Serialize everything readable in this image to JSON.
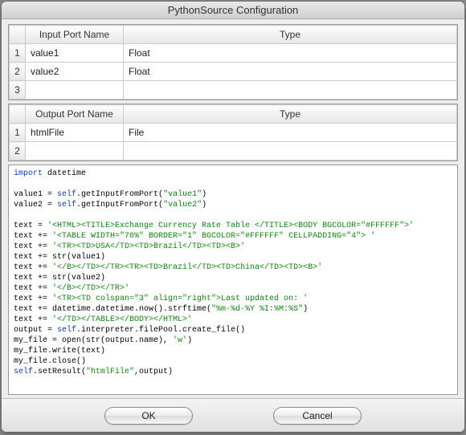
{
  "window": {
    "title": "PythonSource Configuration"
  },
  "inputTable": {
    "headers": {
      "name": "Input Port Name",
      "type": "Type"
    },
    "rows": [
      {
        "num": "1",
        "name": "value1",
        "type": "Float"
      },
      {
        "num": "2",
        "name": "value2",
        "type": "Float"
      },
      {
        "num": "3",
        "name": "",
        "type": ""
      }
    ]
  },
  "outputTable": {
    "headers": {
      "name": "Output Port Name",
      "type": "Type"
    },
    "rows": [
      {
        "num": "1",
        "name": "htmlFile",
        "type": "File"
      },
      {
        "num": "2",
        "name": "",
        "type": ""
      }
    ]
  },
  "code": {
    "l1a": "import",
    "l1b": " datetime",
    "l2a": "value1 = ",
    "l2b": "self",
    "l2c": ".getInputFromPort(",
    "l2d": "\"value1\"",
    "l2e": ")",
    "l3a": "value2 = ",
    "l3b": "self",
    "l3c": ".getInputFromPort(",
    "l3d": "\"value2\"",
    "l3e": ")",
    "l4a": "text = ",
    "l4b": "'<HTML><TITLE>Exchange Currency Rate Table </TITLE><BODY BGCOLOR=\"#FFFFFF\">'",
    "l5a": "text += ",
    "l5b": "'<TABLE WIDTH=\"70%\" BORDER=\"1\" BGCOLOR=\"#FFFFFF\" CELLPADDING=\"4\"> '",
    "l6a": "text += ",
    "l6b": "'<TR><TD>USA</TD><TD>Brazil</TD><TD><B>'",
    "l7a": "text += str(value1)",
    "l8a": "text += ",
    "l8b": "'</B></TD></TR><TR><TD>Brazil</TD><TD>China</TD><TD><B>'",
    "l9a": "text += str(value2)",
    "l10a": "text += ",
    "l10b": "'</B></TD></TR>'",
    "l11a": "text += ",
    "l11b": "'<TR><TD colspan=\"3\" align=\"right\">Last updated on: '",
    "l12a": "text += datetime.datetime.now().strftime(",
    "l12b": "\"%m-%d-%Y %I:%M:%S\"",
    "l12c": ")",
    "l13a": "text += ",
    "l13b": "'</TD></TABLE></BODY></HTML>'",
    "l14a": "output = ",
    "l14b": "self",
    "l14c": ".interpreter.filePool.create_file()",
    "l15a": "my_file = open(str(output.name), ",
    "l15b": "'w'",
    "l15c": ")",
    "l16a": "my_file.write(text)",
    "l17a": "my_file.close()",
    "l18a": "self",
    "l18b": ".setResult(",
    "l18c": "\"htmlFile\"",
    "l18d": ",output)"
  },
  "buttons": {
    "ok": "OK",
    "cancel": "Cancel"
  }
}
